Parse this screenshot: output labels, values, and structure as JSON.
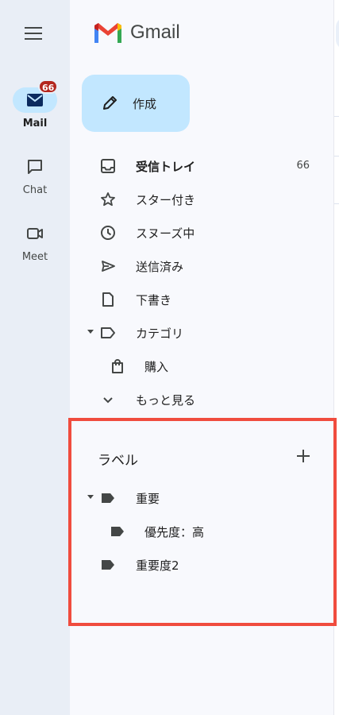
{
  "app": {
    "logo_text": "Gmail"
  },
  "rail": {
    "items": [
      {
        "label": "Mail",
        "badge": "66",
        "icon": "mail-icon",
        "active": true
      },
      {
        "label": "Chat",
        "icon": "chat-icon"
      },
      {
        "label": "Meet",
        "icon": "video-icon"
      }
    ]
  },
  "compose": {
    "label": "作成",
    "icon": "pencil-icon"
  },
  "nav": {
    "items": [
      {
        "label": "受信トレイ",
        "count": "66",
        "icon": "inbox-icon",
        "bold": true
      },
      {
        "label": "スター付き",
        "icon": "star-icon"
      },
      {
        "label": "スヌーズ中",
        "icon": "clock-icon"
      },
      {
        "label": "送信済み",
        "icon": "send-icon"
      },
      {
        "label": "下書き",
        "icon": "draft-icon"
      },
      {
        "label": "カテゴリ",
        "icon": "label-outline-icon",
        "expandable": true
      },
      {
        "label": "購入",
        "icon": "shopping-bag-icon",
        "sub": true
      },
      {
        "label": "もっと見る",
        "icon": "chevron-down-icon"
      }
    ]
  },
  "labels": {
    "title": "ラベル",
    "add_icon": "plus-icon",
    "items": [
      {
        "label": "重要",
        "icon": "label-filled-icon",
        "expandable": true
      },
      {
        "label": "優先度：高",
        "icon": "label-filled-icon",
        "sub": true
      },
      {
        "label": "重要度2",
        "icon": "label-filled-icon"
      }
    ]
  },
  "colors": {
    "rail_bg": "#e9eef6",
    "compose_bg": "#c2e7ff",
    "badge_bg": "#b3261e",
    "highlight_border": "#f04c3e"
  }
}
